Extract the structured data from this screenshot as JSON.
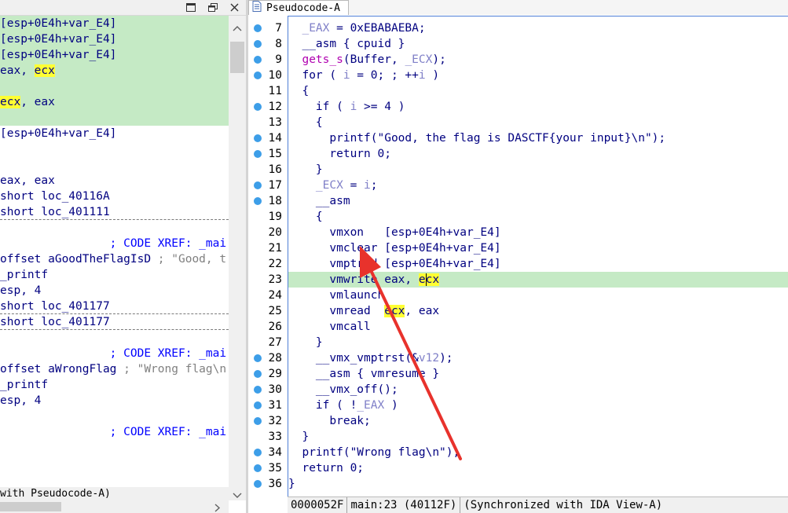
{
  "left_pane": {
    "lines": [
      {
        "text": "[esp+0E4h+var_E4]",
        "hl": true
      },
      {
        "text": "[esp+0E4h+var_E4]",
        "hl": true
      },
      {
        "text": "[esp+0E4h+var_E4]",
        "hl": true
      },
      {
        "pre": "eax, ",
        "yel": "ecx",
        "hl": true
      },
      {
        "text": "",
        "hl": true
      },
      {
        "yel_first": "ecx",
        "post": ", eax",
        "hl": true
      },
      {
        "text": "",
        "hl": true
      },
      {
        "text": "[esp+0E4h+var_E4]"
      },
      {
        "text": ""
      },
      {
        "text": ""
      },
      {
        "text": "eax, eax"
      },
      {
        "text": "short loc_40116A"
      },
      {
        "text": "short loc_401111"
      },
      {
        "sep": true
      },
      {
        "text": ""
      },
      {
        "cmt": "                ; CODE XREF: _mai"
      },
      {
        "pre": "offset aGoodTheFlagIsD ",
        "gray": "; \"Good, t"
      },
      {
        "text": "_printf"
      },
      {
        "text": "esp, 4"
      },
      {
        "text": "short loc_401177"
      },
      {
        "sep": true
      },
      {
        "text": "short loc_401177"
      },
      {
        "sep": true
      },
      {
        "text": ""
      },
      {
        "cmt": "                ; CODE XREF: _mai"
      },
      {
        "pre": "offset aWrongFlag ",
        "gray": "; \"Wrong flag\\n"
      },
      {
        "text": "_printf"
      },
      {
        "text": "esp, 4"
      },
      {
        "text": ""
      },
      {
        "cmt": "                ; CODE XREF: _mai"
      }
    ],
    "status": "with Pseudocode-A)"
  },
  "right_pane": {
    "tab_title": "Pseudocode-A",
    "lines": [
      {
        "n": "7",
        "dot": true,
        "html": "  <span class='v'>_EAX</span> = 0xEBABAEBA;"
      },
      {
        "n": "8",
        "dot": true,
        "html": "  __asm { cpuid }"
      },
      {
        "n": "9",
        "dot": true,
        "html": "  <span class='f'>gets_s</span>(Buffer, <span class='v'>_ECX</span>);"
      },
      {
        "n": "10",
        "dot": true,
        "html": "  for ( <span class='v'>i</span> = 0; ; ++<span class='v'>i</span> )"
      },
      {
        "n": "11",
        "dot": false,
        "html": "  {"
      },
      {
        "n": "12",
        "dot": true,
        "html": "    if ( <span class='v'>i</span> >= 4 )"
      },
      {
        "n": "13",
        "dot": false,
        "html": "    {"
      },
      {
        "n": "14",
        "dot": true,
        "html": "      printf(\"Good, the flag is DASCTF{your input}\\n\");"
      },
      {
        "n": "15",
        "dot": true,
        "html": "      return 0;"
      },
      {
        "n": "16",
        "dot": false,
        "html": "    }"
      },
      {
        "n": "17",
        "dot": true,
        "html": "    <span class='v'>_ECX</span> = <span class='v'>i</span>;"
      },
      {
        "n": "18",
        "dot": true,
        "html": "    __asm"
      },
      {
        "n": "19",
        "dot": false,
        "html": "    {"
      },
      {
        "n": "20",
        "dot": false,
        "html": "      vmxon   [esp+0E4h+var_E4]"
      },
      {
        "n": "21",
        "dot": false,
        "html": "      vmclear [esp+0E4h+var_E4]"
      },
      {
        "n": "22",
        "dot": false,
        "html": "      vmptrld [esp+0E4h+var_E4]"
      },
      {
        "n": "23",
        "dot": false,
        "hl": true,
        "html": "      vmwrite eax, <span class='yel'>e<span class='caret'></span>cx</span>"
      },
      {
        "n": "24",
        "dot": false,
        "html": "      vmlaunch"
      },
      {
        "n": "25",
        "dot": false,
        "html": "      vmread  <span class='yel'>ecx</span>, eax"
      },
      {
        "n": "26",
        "dot": false,
        "html": "      vmcall"
      },
      {
        "n": "27",
        "dot": false,
        "html": "    }"
      },
      {
        "n": "28",
        "dot": true,
        "html": "    __vmx_vmptrst(&amp;<span class='v'>v12</span>);"
      },
      {
        "n": "29",
        "dot": true,
        "html": "    __asm { vmresume }"
      },
      {
        "n": "30",
        "dot": true,
        "html": "    __vmx_off();"
      },
      {
        "n": "31",
        "dot": true,
        "html": "    if ( !<span class='v'>_EAX</span> )"
      },
      {
        "n": "32",
        "dot": true,
        "html": "      break;"
      },
      {
        "n": "33",
        "dot": false,
        "html": "  }"
      },
      {
        "n": "34",
        "dot": true,
        "html": "  printf(\"Wrong flag\\n\");"
      },
      {
        "n": "35",
        "dot": true,
        "html": "  return 0;"
      },
      {
        "n": "36",
        "dot": true,
        "html": "}"
      }
    ],
    "status": [
      "0000052F",
      "main:23 (40112F)",
      "(Synchronized with IDA View-A)"
    ]
  },
  "icons": {
    "maximize": "maximize-icon",
    "restore": "restore-icon",
    "close": "close-icon",
    "scroll_up": "scroll-up-icon",
    "scroll_down": "scroll-down-icon",
    "scroll_right": "scroll-right-icon"
  },
  "colors": {
    "highlight": "#c5eac5",
    "keyword": "#000080",
    "variable": "#8080c8",
    "function": "#b000b0",
    "match": "#ffff33",
    "breakpoint_dot": "#3d9ee8",
    "arrow": "#e8322c"
  }
}
